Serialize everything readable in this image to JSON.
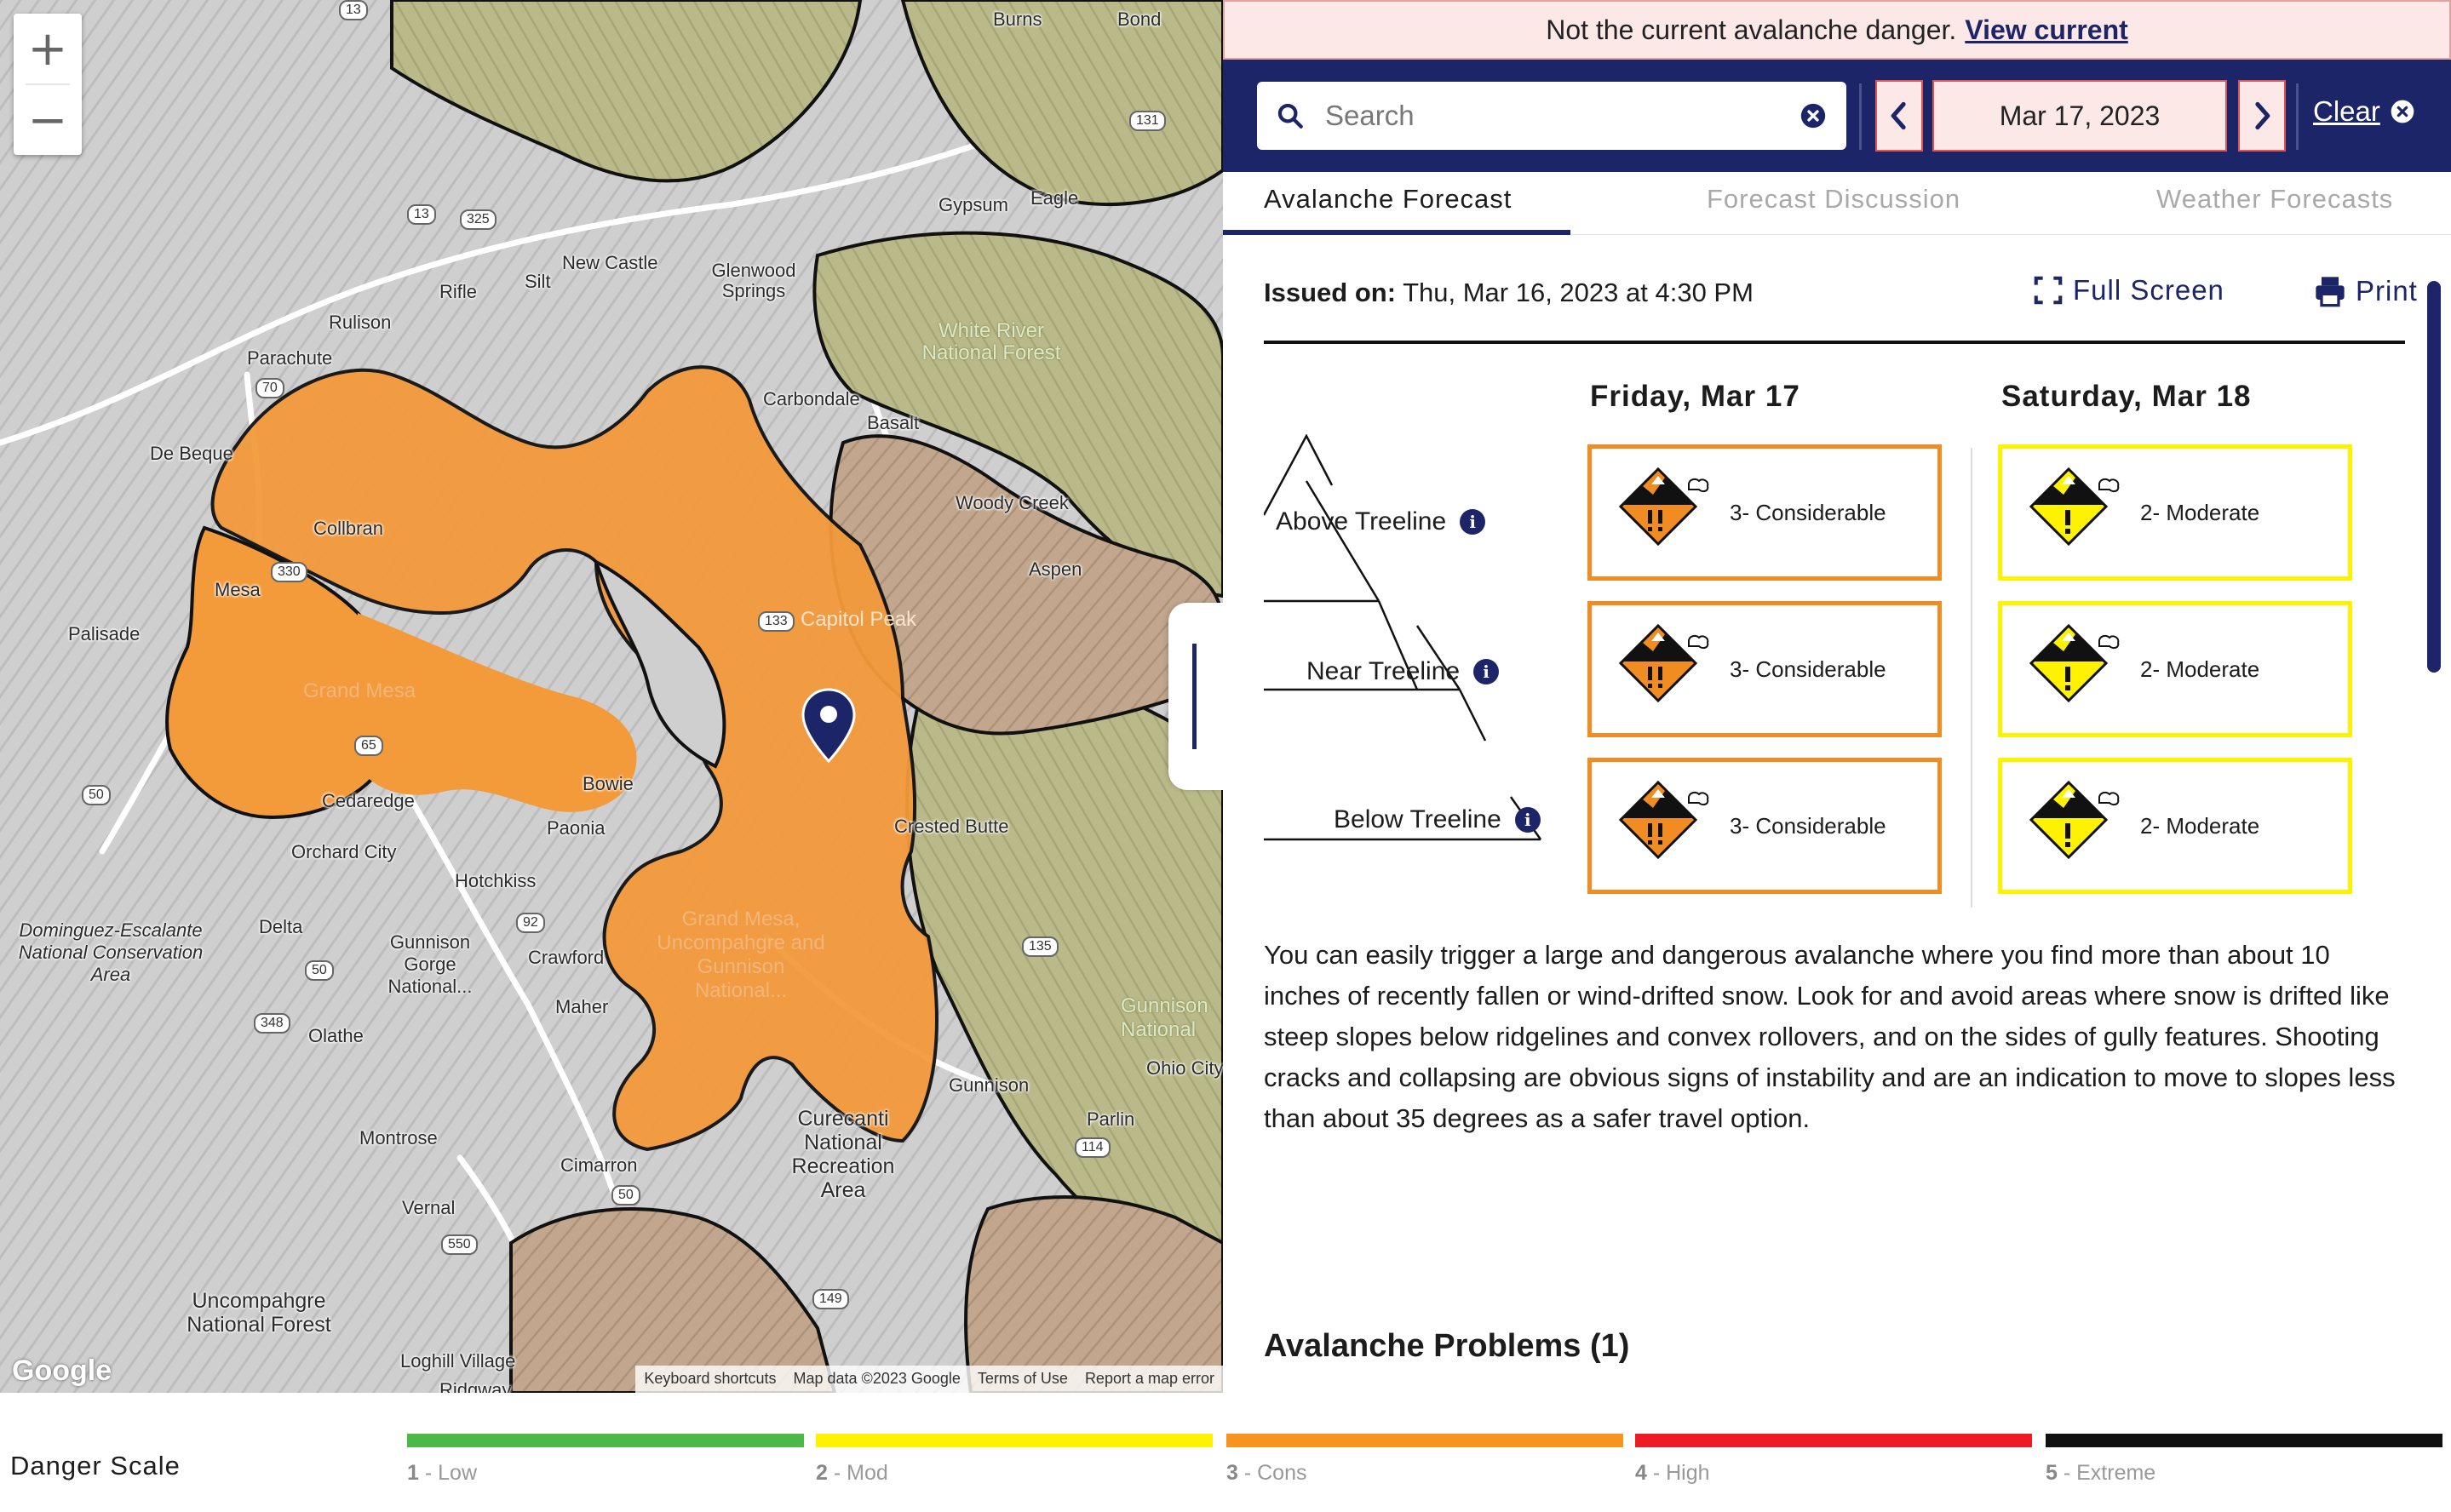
{
  "map": {
    "zoom_in_label": "+",
    "zoom_out_label": "−",
    "google_logo": "Google",
    "attribution": [
      "Keyboard shortcuts",
      "Map data ©2023 Google",
      "Terms of Use",
      "Report a map error"
    ],
    "places": [
      {
        "name": "Burns"
      },
      {
        "name": "Bond"
      },
      {
        "name": "Gypsum"
      },
      {
        "name": "Eagle"
      },
      {
        "name": "New Castle"
      },
      {
        "name": "Glenwood Springs"
      },
      {
        "name": "Rifle"
      },
      {
        "name": "Silt"
      },
      {
        "name": "Rulison"
      },
      {
        "name": "Parachute"
      },
      {
        "name": "White River National Forest"
      },
      {
        "name": "Carbondale"
      },
      {
        "name": "Basalt"
      },
      {
        "name": "De Beque"
      },
      {
        "name": "Collbran"
      },
      {
        "name": "Woody Creek"
      },
      {
        "name": "Aspen"
      },
      {
        "name": "Mesa"
      },
      {
        "name": "Capitol Peak"
      },
      {
        "name": "Palisade"
      },
      {
        "name": "Grand Mesa"
      },
      {
        "name": "Bowie"
      },
      {
        "name": "Paonia"
      },
      {
        "name": "Cedaredge"
      },
      {
        "name": "Crested Butte"
      },
      {
        "name": "Orchard City"
      },
      {
        "name": "Hotchkiss"
      },
      {
        "name": "Dominguez-Escalante National Conservation Area"
      },
      {
        "name": "Delta"
      },
      {
        "name": "Gunnison Gorge National..."
      },
      {
        "name": "Crawford"
      },
      {
        "name": "Grand Mesa, Uncompahgre and Gunnison National..."
      },
      {
        "name": "Maher"
      },
      {
        "name": "Olathe"
      },
      {
        "name": "Gunnison"
      },
      {
        "name": "Parlin"
      },
      {
        "name": "Gunnison National"
      },
      {
        "name": "Ohio City"
      },
      {
        "name": "Montrose"
      },
      {
        "name": "Curecanti National Recreation Area"
      },
      {
        "name": "Cimarron"
      },
      {
        "name": "Vernal"
      },
      {
        "name": "Uncompahgre National Forest"
      },
      {
        "name": "Loghill Village"
      },
      {
        "name": "Ridgway"
      }
    ],
    "shields": [
      "13",
      "325",
      "131",
      "13",
      "70",
      "330",
      "133",
      "65",
      "50",
      "92",
      "50",
      "348",
      "135",
      "114",
      "50",
      "550",
      "149"
    ]
  },
  "alert": {
    "text": "Not the current avalanche danger.",
    "link": "View current"
  },
  "navbar": {
    "search_placeholder": "Search",
    "date": "Mar 17, 2023",
    "clear_label": "Clear"
  },
  "tabs": [
    {
      "label": "Avalanche Forecast",
      "active": true
    },
    {
      "label": "Forecast Discussion",
      "active": false
    },
    {
      "label": "Weather Forecasts",
      "active": false
    }
  ],
  "forecast": {
    "issued_label": "Issued on:",
    "issued_value": "Thu, Mar 16, 2023 at 4:30 PM",
    "full_screen_label": "Full Screen",
    "print_label": "Print",
    "days": [
      {
        "title": "Friday, Mar 17"
      },
      {
        "title": "Saturday, Mar 18"
      }
    ],
    "elevations": [
      "Above Treeline",
      "Near Treeline",
      "Below Treeline"
    ],
    "ratings": {
      "day1": [
        "3- Considerable",
        "3- Considerable",
        "3- Considerable"
      ],
      "day2": [
        "2- Moderate",
        "2- Moderate",
        "2- Moderate"
      ]
    },
    "summary": "You can easily trigger a large and dangerous avalanche where you find more than about 10 inches of recently fallen or wind-drifted snow. Look for and avoid areas where snow is drifted like steep slopes below ridgelines and convex rollovers, and on the sides of gully features. Shooting cracks and collapsing are obvious signs of instability and are an indication to move to slopes less than about 35 degrees as a safer travel option.",
    "problems_heading": "Avalanche Problems (1)"
  },
  "danger_scale": {
    "title": "Danger Scale",
    "levels": [
      {
        "num": "1",
        "label": "- Low",
        "color": "#4bb848"
      },
      {
        "num": "2",
        "label": "- Mod",
        "color": "#fff200"
      },
      {
        "num": "3",
        "label": "- Cons",
        "color": "#f7941e"
      },
      {
        "num": "4",
        "label": "- High",
        "color": "#ed1c24"
      },
      {
        "num": "5",
        "label": "- Extreme",
        "color": "#111111"
      }
    ]
  },
  "colors": {
    "navy": "#1d2569",
    "considerable": "#f08c22",
    "moderate": "#fff200",
    "alert_bg": "#fde8e8"
  }
}
